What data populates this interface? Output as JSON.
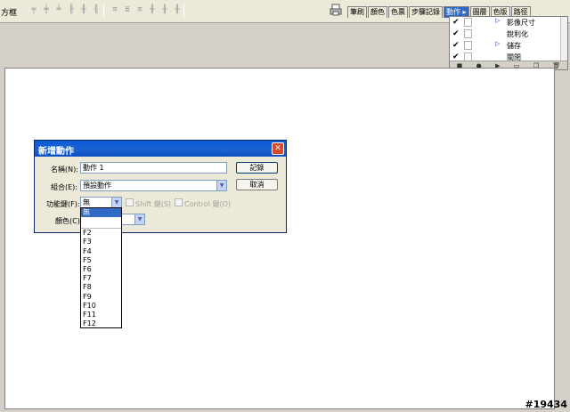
{
  "options_bar": {
    "label": "方框"
  },
  "palette_tabs": {
    "items": [
      "筆刷",
      "顏色",
      "色票",
      "步驟記錄",
      "動作",
      "圖層",
      "色版",
      "路徑"
    ],
    "active_index": 4
  },
  "actions_palette": {
    "rows": [
      {
        "label": "影像尺寸",
        "has_triangle": true
      },
      {
        "label": "銳利化",
        "has_triangle": false
      },
      {
        "label": "儲存",
        "has_triangle": true
      },
      {
        "label": "關閉",
        "has_triangle": false
      }
    ]
  },
  "dialog": {
    "title": "新增動作",
    "name_label": "名稱(N):",
    "name_value": "動作 1",
    "set_label": "組合(E):",
    "set_value": "預設動作",
    "fkey_label": "功能鍵(F):",
    "fkey_value": "無",
    "shift_label": "Shift 鍵(S)",
    "control_label": "Control 鍵(O)",
    "color_label": "顏色(C):",
    "record_button": "記錄",
    "cancel_button": "取消"
  },
  "fkey_options": [
    "無",
    "",
    "F2",
    "F3",
    "F4",
    "F5",
    "F6",
    "F7",
    "F8",
    "F9",
    "F10",
    "F11",
    "F12"
  ],
  "fkey_selected_index": 0,
  "watermark": "#19434",
  "colors": {
    "title_bar": "#0a5bd6",
    "selection": "#316ac5",
    "close_button": "#d9492a"
  }
}
